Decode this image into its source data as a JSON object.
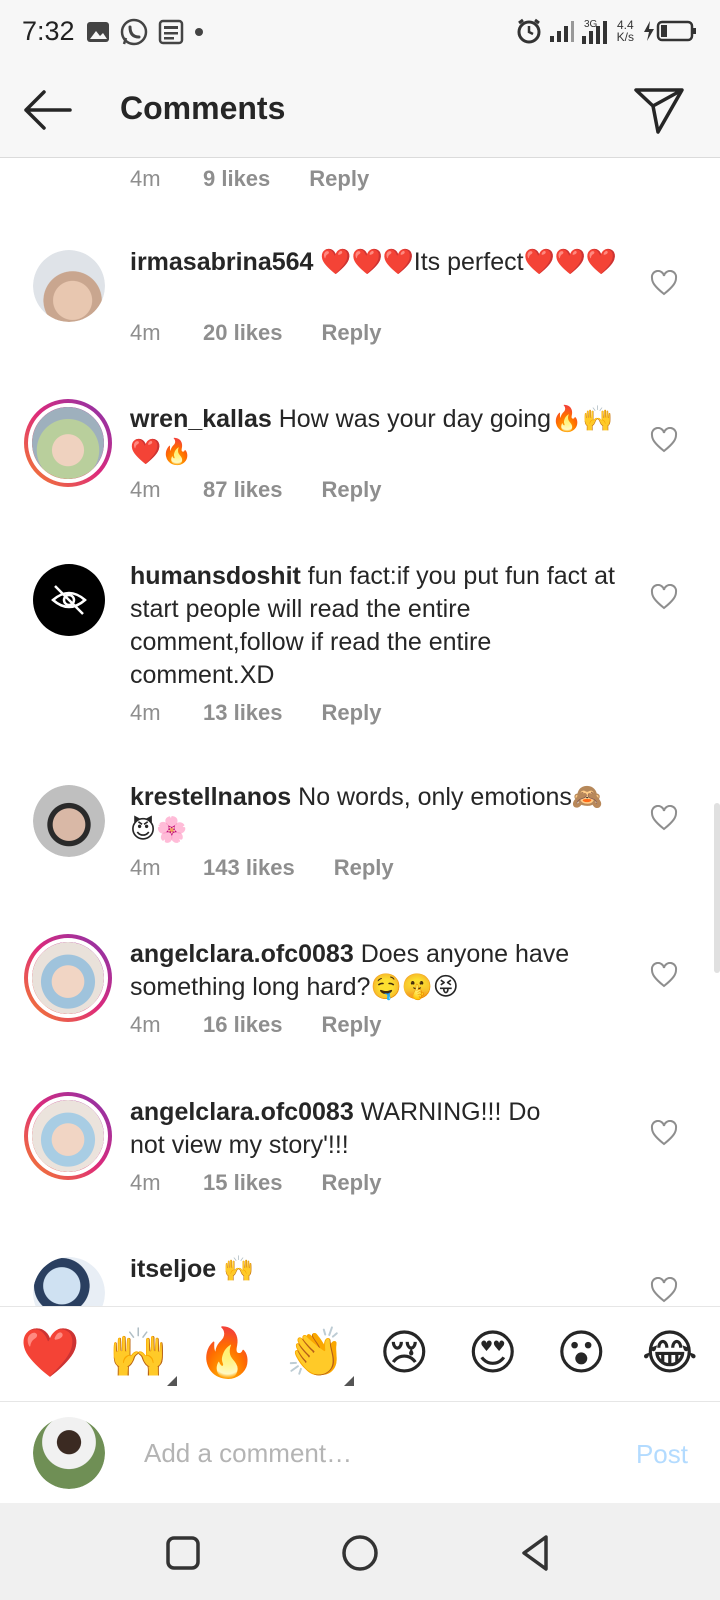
{
  "status_bar": {
    "time": "7:32",
    "net_speed_value": "4.4",
    "net_speed_unit": "K/s",
    "signal_label": "3G"
  },
  "header": {
    "title": "Comments",
    "back_icon": "arrow-left-icon",
    "share_icon": "paper-plane-icon"
  },
  "top_meta": {
    "time": "4m",
    "likes": "9 likes",
    "reply": "Reply"
  },
  "comments": [
    {
      "username": "irmasabrina564",
      "text": "❤️❤️❤️Its perfect❤️❤️❤️",
      "time": "4m",
      "likes": "20 likes",
      "reply": "Reply",
      "story_ring": false
    },
    {
      "username": "wren_kallas",
      "text": "How was your day going🔥🙌❤️🔥",
      "time": "4m",
      "likes": "87 likes",
      "reply": "Reply",
      "story_ring": true
    },
    {
      "username": "humansdoshit",
      "text": "fun fact:if you put fun fact at start people will read the entire comment,follow if read the entire comment.XD",
      "time": "4m",
      "likes": "13 likes",
      "reply": "Reply",
      "story_ring": false
    },
    {
      "username": "krestellnanos",
      "text": "No words, only emotions🙈😈🌸",
      "time": "4m",
      "likes": "143 likes",
      "reply": "Reply",
      "story_ring": false
    },
    {
      "username": "angelclara.ofc0083",
      "text": "Does anyone have something long hard?🤤🤫😝",
      "time": "4m",
      "likes": "16 likes",
      "reply": "Reply",
      "story_ring": true
    },
    {
      "username": "angelclara.ofc0083",
      "text": "WARNING!!! Do not view my story'!!!",
      "time": "4m",
      "likes": "15 likes",
      "reply": "Reply",
      "story_ring": true
    },
    {
      "username": "itseljoe",
      "text": "🙌",
      "story_ring": false
    }
  ],
  "emoji_bar": [
    "❤️",
    "🙌",
    "🔥",
    "👏",
    "😢",
    "😍",
    "😮",
    "😂"
  ],
  "compose": {
    "placeholder": "Add a comment…",
    "post_label": "Post"
  },
  "nav_bar": [
    "square-icon",
    "circle-icon",
    "triangle-back-icon"
  ],
  "colors": {
    "text": "#262626",
    "meta": "#8e8e8e",
    "post_disabled": "#b3dbff",
    "heart_red": "#ed4956"
  }
}
